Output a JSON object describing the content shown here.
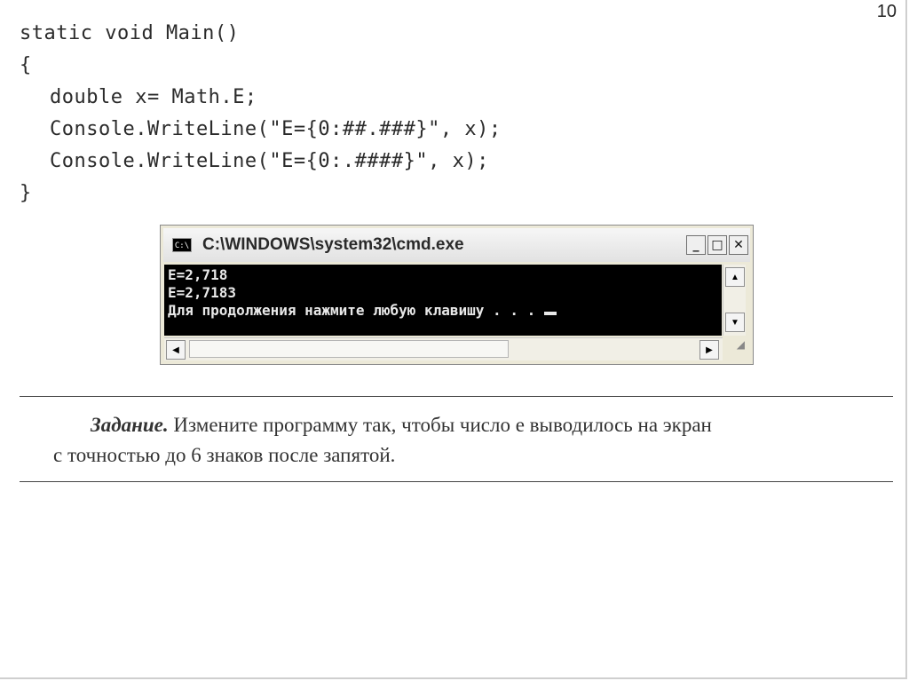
{
  "slide": {
    "number": "10"
  },
  "code": {
    "lines": [
      "static void Main()",
      "{",
      "double x= Math.E;",
      "Console.WriteLine(\"E={0:##.###}\", x);",
      "Console.WriteLine(\"E={0:.####}\", x);",
      "}"
    ]
  },
  "cmd": {
    "icon_label": "C:\\",
    "title": "C:\\WINDOWS\\system32\\cmd.exe",
    "minimize_label": "_",
    "maximize_label": "□",
    "close_label": "✕",
    "output": [
      "E=2,718",
      "E=2,7183",
      "Для продолжения нажмите любую клавишу . . . "
    ],
    "scroll_up": "▲",
    "scroll_down": "▼",
    "scroll_left": "◀",
    "scroll_right": "▶"
  },
  "task": {
    "label": "Задание.",
    "line1": " Измените программу так, чтобы число e выводилось на экран",
    "line2": "с точностью до 6 знаков после запятой."
  }
}
